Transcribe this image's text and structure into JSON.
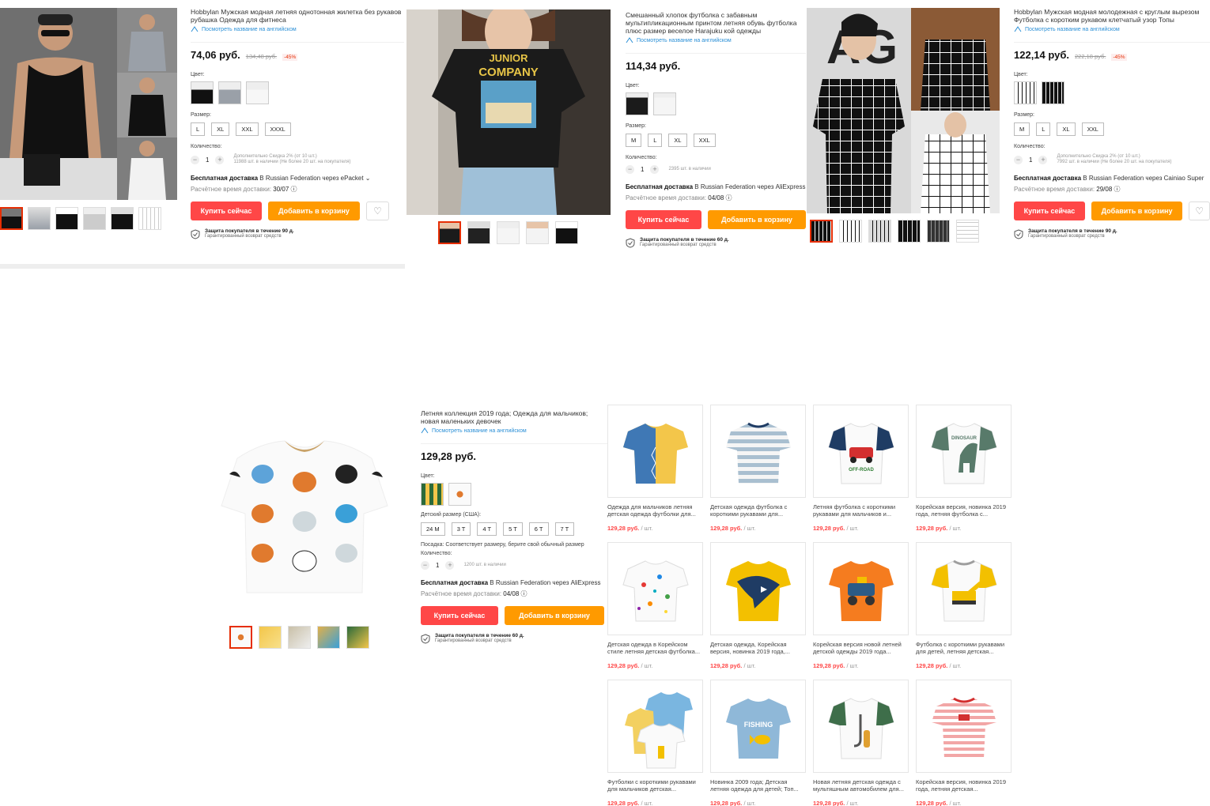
{
  "products": [
    {
      "title": "Hobbylan Мужская модная летняя однотонная жилетка без рукавов рубашка Одежда для фитнеса",
      "en_link": "Посмотреть название на английском",
      "price": "74,06 руб.",
      "old_price": "134,48 руб.",
      "discount": "-45%",
      "color_label": "Цвет:",
      "size_label": "Размер:",
      "sizes": [
        "L",
        "XL",
        "XXL",
        "XXXL"
      ],
      "qty_label": "Количество:",
      "qty": "1",
      "qty_note_1": "Дополнительно Скидка 2% (от 10 шт.)",
      "qty_note_2": "11988 шт. в наличии (Не более 20 шт. на покупателя)",
      "ship_bold": "Бесплатная доставка",
      "ship_rest": " В Russian Federation через ePacket ⌄",
      "eta_label": "Расчётное время доставки: ",
      "eta_date": "30/07",
      "buy": "Купить сейчас",
      "cart": "Добавить в корзину",
      "prot_1": "Защита покупателя в течение 90 д.",
      "prot_2": "Гарантированный возврат средств"
    },
    {
      "title": "Смешанный хлопок футболка с забавным мультипликационным принтом летняя обувь футболка плюс размер веселое Harajuku кой одежды",
      "en_link": "Посмотреть название на английском",
      "price": "114,34 руб.",
      "color_label": "Цвет:",
      "size_label": "Размер:",
      "sizes": [
        "M",
        "L",
        "XL",
        "XXL"
      ],
      "qty_label": "Количество:",
      "qty": "1",
      "qty_note_1": "2395 шт. в наличии",
      "ship_bold": "Бесплатная доставка",
      "ship_rest": " В Russian Federation через AliExpress",
      "eta_label": "Расчётное время доставки: ",
      "eta_date": "04/08",
      "buy": "Купить сейчас",
      "cart": "Добавить в корзину",
      "prot_1": "Защита покупателя в течение 60 д.",
      "prot_2": "Гарантированный возврат средств",
      "print_line1": "JUNIOR",
      "print_line2": "COMPANY"
    },
    {
      "title": "Hobbylan Мужская модная молодежная с круглым вырезом Футболка с коротким рукавом клетчатый узор Топы",
      "en_link": "Посмотреть название на английском",
      "price": "122,14 руб.",
      "old_price": "222,18 руб.",
      "discount": "-45%",
      "color_label": "Цвет:",
      "size_label": "Размер:",
      "sizes": [
        "M",
        "L",
        "XL",
        "XXL"
      ],
      "qty_label": "Количество:",
      "qty": "1",
      "qty_note_1": "Дополнительно Скидка 2% (от 10 шт.)",
      "qty_note_2": "7992 шт. в наличии (Не более 20 шт. на покупателя)",
      "ship_bold": "Бесплатная доставка",
      "ship_rest": " В Russian Federation через Cainiao Super",
      "eta_label": "Расчётное время доставки: ",
      "eta_date": "29/08",
      "buy": "Купить сейчас",
      "cart": "Добавить в корзину",
      "prot_1": "Защита покупателя в течение 90 д.",
      "prot_2": "Гарантированный возврат средств",
      "print_text": "AG"
    },
    {
      "title": "Летняя коллекция 2019 года; Одежда для мальчиков; новая маленьких девочек",
      "en_link": "Посмотреть название на английском",
      "price": "129,28 руб.",
      "color_label": "Цвет:",
      "size_label": "Детский размер (США):",
      "sizes": [
        "24 M",
        "3 T",
        "4 T",
        "5 T",
        "6 T",
        "7 T"
      ],
      "fit_note": "Посадка: Соответствует размеру, берите свой обычный размер",
      "qty_label": "Количество:",
      "qty": "1",
      "qty_note_1": "1200 шт. в наличии",
      "ship_bold": "Бесплатная доставка",
      "ship_rest": " В Russian Federation через AliExpress",
      "eta_label": "Расчётное время доставки: ",
      "eta_date": "04/08",
      "buy": "Купить сейчас",
      "cart": "Добавить в корзину",
      "prot_1": "Защита покупателя в течение 60 д.",
      "prot_2": "Гарантированный возврат средств"
    }
  ],
  "unit": " / шт.",
  "recommended": [
    {
      "title": "Одежда для мальчиков летняя детская одежда футболки для...",
      "price": "129,28 руб."
    },
    {
      "title": "Детская одежда футболка с короткими рукавами для...",
      "price": "129,28 руб."
    },
    {
      "title": "Летняя футболка с короткими рукавами для мальчиков и...",
      "price": "129,28 руб.",
      "print": "OFF-ROAD"
    },
    {
      "title": "Корейская версия, новинка 2019 года, летняя футболка с...",
      "price": "129,28 руб.",
      "print": "DINOSAUR"
    },
    {
      "title": "Детская одежда в Корейском стиле летняя детская футболка...",
      "price": "129,28 руб."
    },
    {
      "title": "Детская одежда, Корейская версия, новинка 2019 года,...",
      "price": "129,28 руб."
    },
    {
      "title": "Корейская версия новой летней детской одежды 2019 года...",
      "price": "129,28 руб."
    },
    {
      "title": "Футболка с короткими рукавами для детей, летняя детская...",
      "price": "129,28 руб."
    },
    {
      "title": "Футболки с короткими рукавами для мальчиков детская...",
      "price": "129,28 руб."
    },
    {
      "title": "Новинка 2009 года; Детская летняя одежда для детей; Топ...",
      "price": "129,28 руб.",
      "print": "FISHING"
    },
    {
      "title": "Новая летняя детская одежда с мультяшным автомобилем для...",
      "price": "129,28 руб."
    },
    {
      "title": "Корейская версия, новинка 2019 года, летняя детская...",
      "price": "129,28 руб."
    }
  ],
  "colors": {
    "buy": "#ff4747",
    "cart": "#ff9a00",
    "link": "#2a8fd6",
    "discount": "#e62e04"
  }
}
